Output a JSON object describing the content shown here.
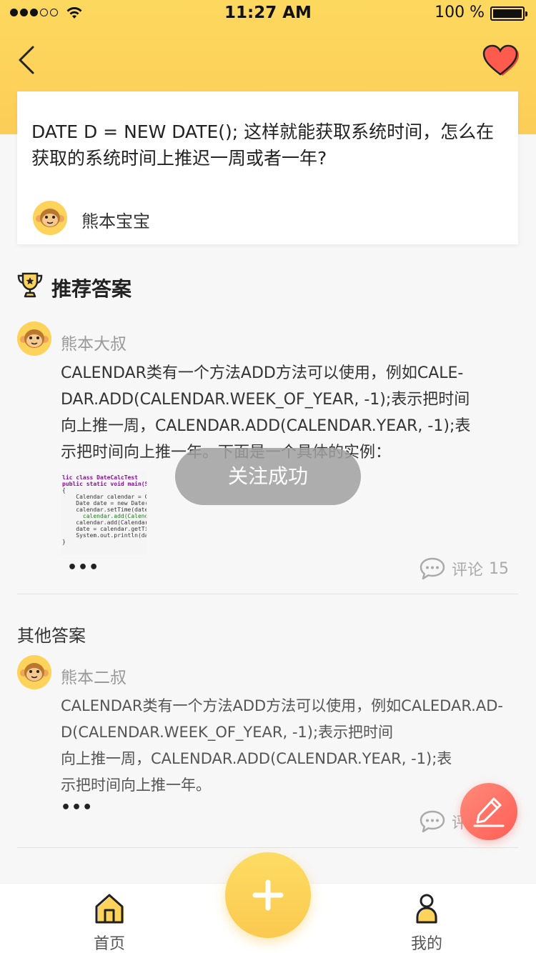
{
  "status_bar": {
    "time": "11:27 AM",
    "battery": "100 %"
  },
  "colors": {
    "brand_yellow": "#fdd35c",
    "accent_red": "#ff5e55",
    "text_dark": "#222222",
    "text_gray": "#999999"
  },
  "icons": {
    "back": "chevron-left-icon",
    "favorite": "heart-icon",
    "recommend": "trophy-icon",
    "comment": "chat-bubble-icon",
    "edit": "pencil-icon",
    "add": "plus-icon",
    "home": "home-icon",
    "me": "person-icon"
  },
  "question": {
    "title": "DATE D = NEW DATE(); 这样就能获取系统时间，怎么在获取的系统时间上推迟一周或者一年?",
    "author": "熊本宝宝"
  },
  "recommended": {
    "section_title": "推荐答案",
    "author": "熊本大叔",
    "lines": [
      "CALENDAR类有一个方法ADD方法可以使用，例如CALE-",
      "DAR.ADD(CALENDAR.WEEK_OF_YEAR, -1);表示把时间",
      "向上推一周，CALENDAR.ADD(CALENDAR.YEAR, -1);表",
      "示把时间向上推一年。下面是一个具体的实例："
    ],
    "code": [
      "lic class DateCalcTest",
      "",
      "public static void main(Str",
      "{",
      "    Calendar calendar = Cal",
      "    Date date = new Date(Sy",
      "    calendar.setTime(date);",
      "      calendar.add(Calendar",
      "    calendar.add(Calendar.Y",
      "    date = calendar.getTime",
      "    System.out.println(date",
      "}"
    ],
    "more": "•••",
    "comment_label": "评论",
    "comment_count": "15"
  },
  "other": {
    "section_title": "其他答案",
    "author": "熊本二叔",
    "lines": [
      "CALENDAR类有一个方法ADD方法可以使用，例如CALEDAR.AD-",
      "D(CALENDAR.WEEK_OF_YEAR, -1);表示把时间",
      "向上推一周，CALENDAR.ADD(CALENDAR.YEAR, -1);表",
      "示把时间向上推一年。"
    ],
    "more": "•••",
    "comment_label": "评"
  },
  "toast": "关注成功",
  "tabbar": {
    "home": "首页",
    "me": "我的"
  }
}
